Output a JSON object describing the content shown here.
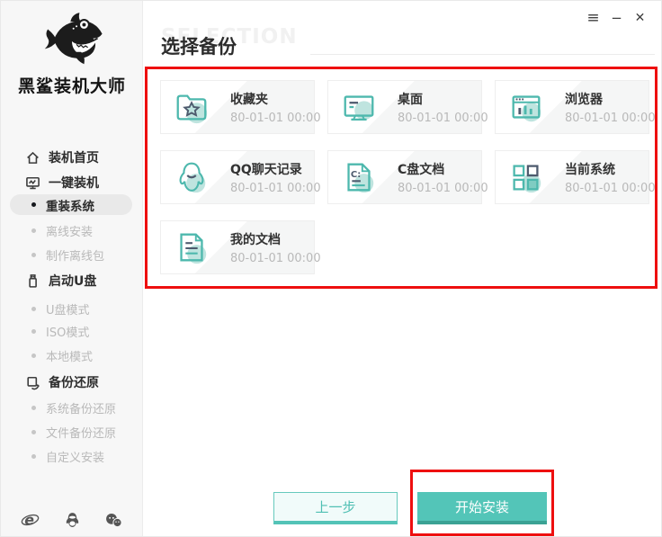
{
  "window": {
    "controls": {
      "menu_glyph": "≡",
      "minimize_glyph": "−",
      "close_glyph": "✕"
    }
  },
  "sidebar": {
    "logo_text": "黑鲨装机大师",
    "menu": [
      {
        "label": "装机首页",
        "type": "top",
        "icon": "home-icon",
        "active": false
      },
      {
        "label": "一键装机",
        "type": "top",
        "icon": "one-key-install-icon",
        "active": false
      },
      {
        "label": "重装系统",
        "type": "sub",
        "active": true
      },
      {
        "label": "离线安装",
        "type": "sub",
        "active": false
      },
      {
        "label": "制作离线包",
        "type": "sub",
        "active": false
      },
      {
        "label": "启动U盘",
        "type": "top",
        "icon": "usb-drive-icon",
        "active": false
      },
      {
        "label": "U盘模式",
        "type": "sub",
        "active": false
      },
      {
        "label": "ISO模式",
        "type": "sub",
        "active": false
      },
      {
        "label": "本地模式",
        "type": "sub",
        "active": false
      },
      {
        "label": "备份还原",
        "type": "top",
        "icon": "backup-restore-icon",
        "active": false
      },
      {
        "label": "系统备份还原",
        "type": "sub",
        "active": false
      },
      {
        "label": "文件备份还原",
        "type": "sub",
        "active": false
      },
      {
        "label": "自定义安装",
        "type": "sub",
        "active": false
      }
    ],
    "footer_icons": [
      {
        "name": "ie-browser-icon",
        "glyph": "e"
      },
      {
        "name": "qq-icon"
      },
      {
        "name": "wechat-icon"
      }
    ]
  },
  "main": {
    "watermark": "SELECTION",
    "title": "选择备份",
    "cards": [
      {
        "title": "收藏夹",
        "date": "80-01-01 00:00",
        "icon": "favorites-folder-icon"
      },
      {
        "title": "桌面",
        "date": "80-01-01 00:00",
        "icon": "desktop-icon"
      },
      {
        "title": "浏览器",
        "date": "80-01-01 00:00",
        "icon": "browser-icon"
      },
      {
        "title": "QQ聊天记录",
        "date": "80-01-01 00:00",
        "icon": "qq-chat-icon"
      },
      {
        "title": "C盘文档",
        "date": "80-01-01 00:00",
        "icon": "c-drive-doc-icon",
        "icon_text": "C:"
      },
      {
        "title": "当前系统",
        "date": "80-01-01 00:00",
        "icon": "current-system-icon"
      },
      {
        "title": "我的文档",
        "date": "80-01-01 00:00",
        "icon": "my-documents-icon"
      }
    ],
    "buttons": {
      "prev": "上一步",
      "start": "开始安装"
    }
  },
  "colors": {
    "teal": "#53c5b8",
    "teal_dark": "#3ba294",
    "icon_teal": "#4db8ad",
    "icon_light_fill": "#bfe4df",
    "icon_navy": "#4e5b6e",
    "annotation_red": "#ee0f0f",
    "sidebar_bg": "#f7f7f7",
    "active_pill": "#e9e9e9"
  }
}
